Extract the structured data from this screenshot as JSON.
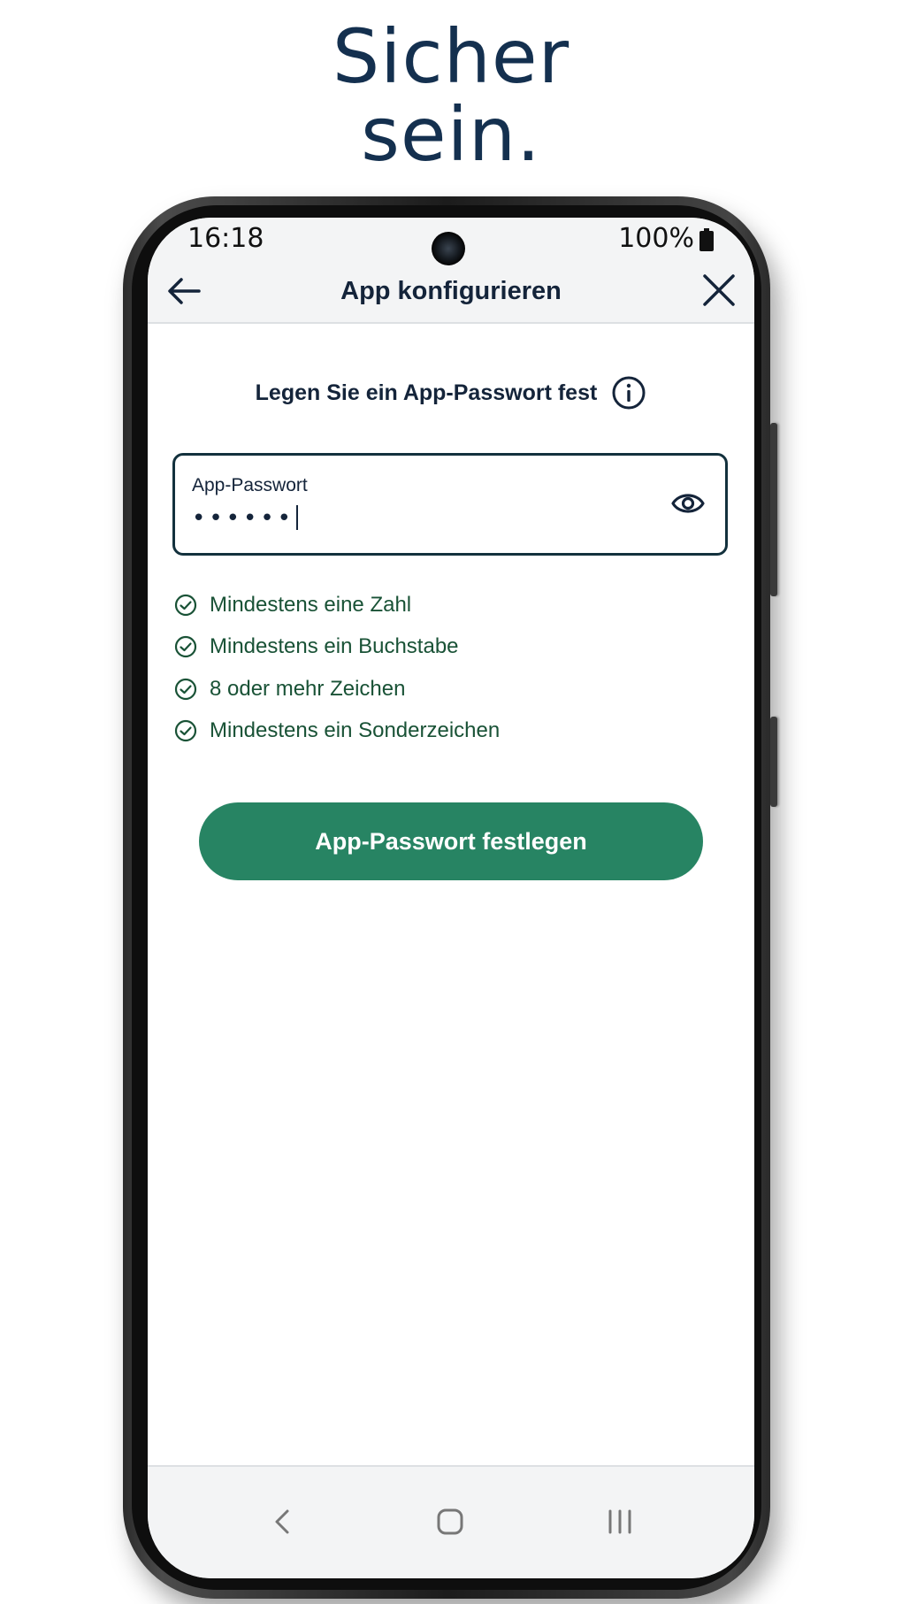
{
  "headline": {
    "line1": "Sicher",
    "line2": "sein."
  },
  "status_bar": {
    "time": "16:18",
    "battery": "100%"
  },
  "app_bar": {
    "title": "App konfigurieren",
    "back_icon": "arrow-left-icon",
    "close_icon": "close-icon"
  },
  "content": {
    "subheading": "Legen Sie ein App-Passwort fest",
    "info_icon": "info-icon",
    "password_field": {
      "label": "App-Passwort",
      "value": "••••••",
      "toggle_icon": "eye-icon"
    },
    "requirements": [
      "Mindestens eine Zahl",
      "Mindestens ein Buchstabe",
      "8 oder mehr Zeichen",
      "Mindestens ein Sonderzeichen"
    ],
    "submit_label": "App-Passwort festlegen"
  },
  "colors": {
    "headline": "#14304f",
    "text_dark": "#14243a",
    "requirement_green": "#195236",
    "button_green": "#278463",
    "bar_bg": "#f3f4f5"
  },
  "nav_bar": {
    "back_icon": "chevron-left-icon",
    "home_icon": "home-icon",
    "recents_icon": "recents-icon"
  }
}
